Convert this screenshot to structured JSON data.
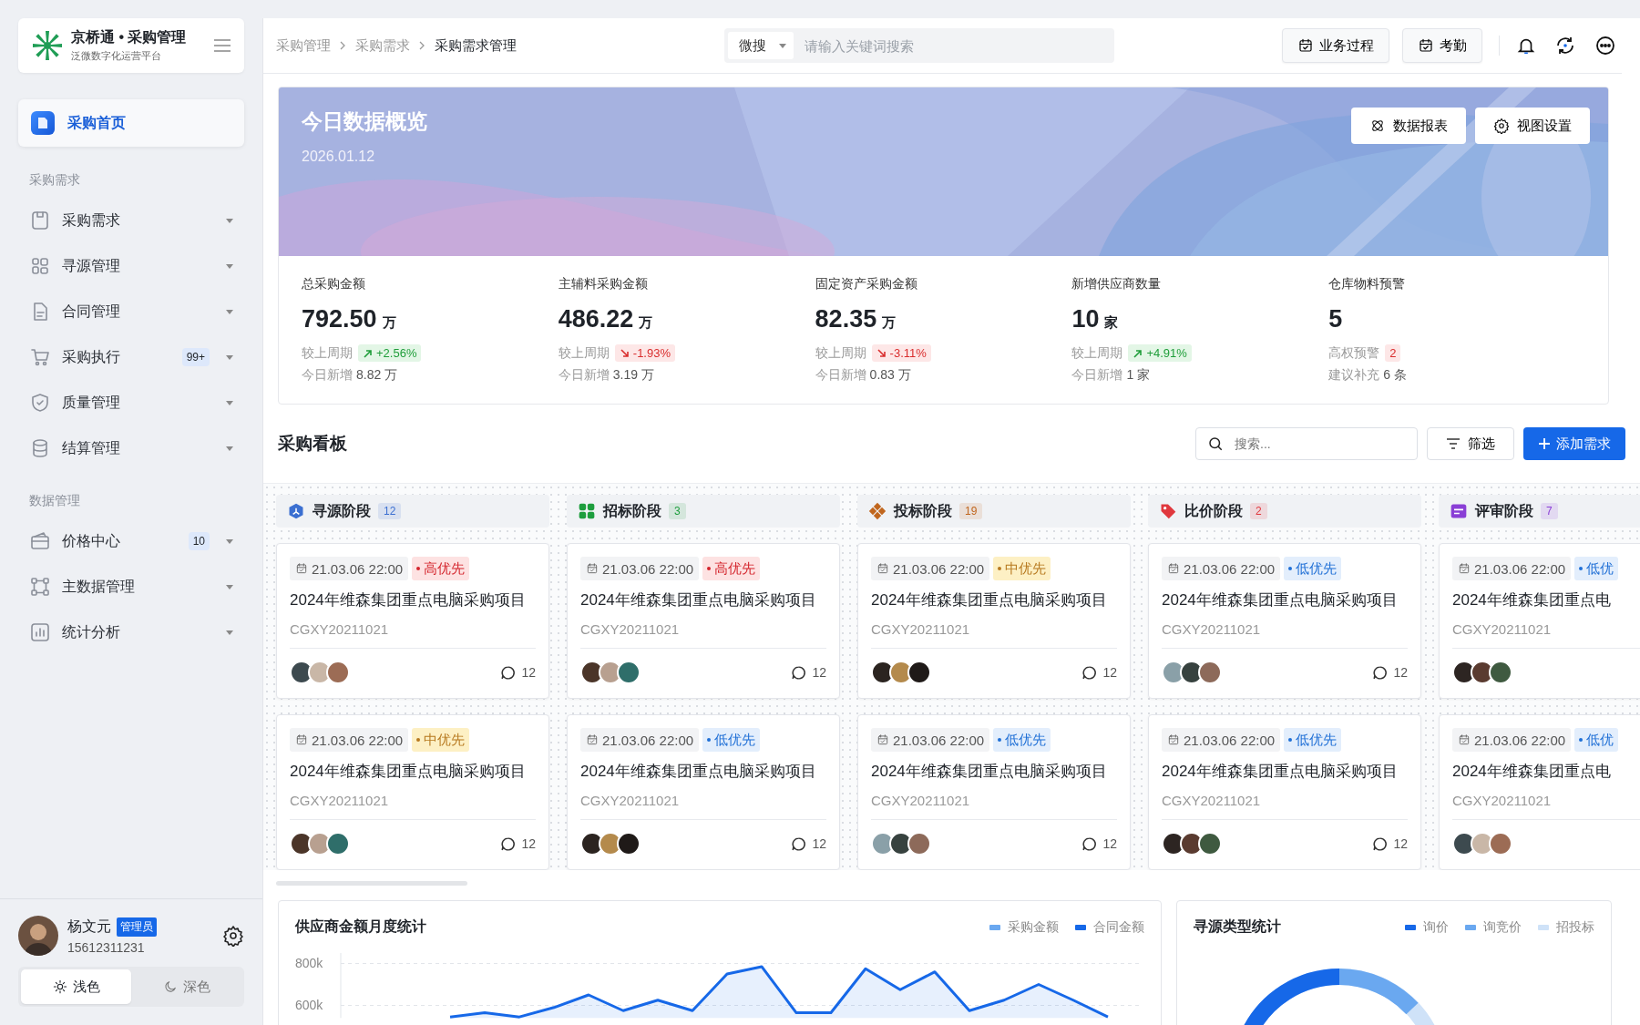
{
  "sidebar": {
    "brand": {
      "title": "京桥通 • 采购管理",
      "subtitle": "泛微数字化运营平台"
    },
    "home": {
      "label": "采购首页",
      "selected": true
    },
    "groups": [
      {
        "title": "采购需求",
        "items": [
          {
            "label": "采购需求"
          },
          {
            "label": "寻源管理"
          },
          {
            "label": "合同管理"
          },
          {
            "label": "采购执行",
            "badge": "99+"
          },
          {
            "label": "质量管理"
          },
          {
            "label": "结算管理"
          }
        ]
      },
      {
        "title": "数据管理",
        "items": [
          {
            "label": "价格中心",
            "badge": "10"
          },
          {
            "label": "主数据管理"
          },
          {
            "label": "统计分析"
          }
        ]
      }
    ],
    "user": {
      "name": "杨文元",
      "role": "管理员",
      "phone": "15612311231"
    },
    "themes": [
      {
        "label": "浅色",
        "selected": true
      },
      {
        "label": "深色",
        "selected": false
      }
    ]
  },
  "topbar": {
    "breadcrumb": [
      "采购管理",
      "采购需求",
      "采购需求管理"
    ],
    "search": {
      "scope": "微搜",
      "placeholder": "请输入关键词搜索"
    },
    "buttons": [
      "业务过程",
      "考勤"
    ]
  },
  "overview": {
    "title": "今日数据概览",
    "date": "2026.01.12",
    "buttons": [
      "数据报表",
      "视图设置"
    ],
    "stats": [
      {
        "label": "总采购金额",
        "value": "792.50",
        "unit": "万",
        "compare_label": "较上周期",
        "change": "+2.56%",
        "kind": "up",
        "sub_label": "今日新增",
        "sub_value": "8.82 万"
      },
      {
        "label": "主辅料采购金额",
        "value": "486.22",
        "unit": "万",
        "compare_label": "较上周期",
        "change": "-1.93%",
        "kind": "down",
        "sub_label": "今日新增",
        "sub_value": "3.19 万"
      },
      {
        "label": "固定资产采购金额",
        "value": "82.35",
        "unit": "万",
        "compare_label": "较上周期",
        "change": "-3.11%",
        "kind": "down",
        "sub_label": "今日新增",
        "sub_value": "0.83 万"
      },
      {
        "label": "新增供应商数量",
        "value": "10",
        "unit": "家",
        "compare_label": "较上周期",
        "change": "+4.91%",
        "kind": "up",
        "sub_label": "今日新增",
        "sub_value": "1 家"
      },
      {
        "label": "仓库物料预警",
        "value": "5",
        "compare_label": "高权预警",
        "change": "2",
        "kind": "alert",
        "sub_label": "建议补充",
        "sub_value": "6 条"
      }
    ]
  },
  "board": {
    "title": "采购看板",
    "search_placeholder": "搜索...",
    "filter": "筛选",
    "add": "添加需求",
    "columns": [
      {
        "title": "寻源阶段",
        "count": "12",
        "color": "#3b6fd1",
        "cards": [
          {
            "date": "21.03.06 22:00",
            "kind": "high",
            "tag": "高优先",
            "title": "2024年维森集团重点电脑采购项目",
            "code": "CGXY20211021",
            "comments": "12"
          },
          {
            "date": "21.03.06 22:00",
            "kind": "mid",
            "tag": "中优先",
            "title": "2024年维森集团重点电脑采购项目",
            "code": "CGXY20211021",
            "comments": "12"
          }
        ]
      },
      {
        "title": "招标阶段",
        "count": "3",
        "color": "#1e9e3e",
        "cards": [
          {
            "date": "21.03.06 22:00",
            "kind": "high",
            "tag": "高优先",
            "title": "2024年维森集团重点电脑采购项目",
            "code": "CGXY20211021",
            "comments": "12"
          },
          {
            "date": "21.03.06 22:00",
            "kind": "low",
            "tag": "低优先",
            "title": "2024年维森集团重点电脑采购项目",
            "code": "CGXY20211021",
            "comments": "12"
          }
        ]
      },
      {
        "title": "投标阶段",
        "count": "19",
        "color": "#c0661e",
        "cards": [
          {
            "date": "21.03.06 22:00",
            "kind": "mid",
            "tag": "中优先",
            "title": "2024年维森集团重点电脑采购项目",
            "code": "CGXY20211021",
            "comments": "12"
          },
          {
            "date": "21.03.06 22:00",
            "kind": "low",
            "tag": "低优先",
            "title": "2024年维森集团重点电脑采购项目",
            "code": "CGXY20211021",
            "comments": "12"
          }
        ]
      },
      {
        "title": "比价阶段",
        "count": "2",
        "color": "#e0383e",
        "cards": [
          {
            "date": "21.03.06 22:00",
            "kind": "low",
            "tag": "低优先",
            "title": "2024年维森集团重点电脑采购项目",
            "code": "CGXY20211021",
            "comments": "12"
          },
          {
            "date": "21.03.06 22:00",
            "kind": "low",
            "tag": "低优先",
            "title": "2024年维森集团重点电脑采购项目",
            "code": "CGXY20211021",
            "comments": "12"
          }
        ]
      },
      {
        "title": "评审阶段",
        "count": "7",
        "color": "#8a3fd6",
        "cards": [
          {
            "date": "21.03.06 22:00",
            "kind": "low",
            "tag": "低优",
            "title": "2024年维森集团重点电",
            "code": "CGXY20211021"
          },
          {
            "date": "21.03.06 22:00",
            "kind": "low",
            "tag": "低优",
            "title": "2024年维森集团重点电",
            "code": "CGXY20211021"
          }
        ]
      }
    ]
  },
  "charts": [
    {
      "title": "供应商金额月度统计",
      "chart_data": {
        "type": "area",
        "ylim": [
          540000,
          850000
        ],
        "yticks": [
          {
            "value": 600000,
            "label": "600k"
          },
          {
            "value": 800000,
            "label": "800k"
          }
        ],
        "series": [
          {
            "name": "采购金额",
            "color": "#6aa8f0",
            "values": [
              null,
              null,
              null,
              null,
              null,
              null,
              null,
              null,
              null,
              null,
              null,
              null,
              null,
              null,
              null,
              null,
              null,
              null,
              null,
              null
            ]
          },
          {
            "name": "合同金额",
            "color": "#1668e8",
            "values": [
              545000,
              565000,
              545000,
              590000,
              650000,
              575000,
              625000,
              575000,
              750000,
              785000,
              565000,
              565000,
              775000,
              675000,
              760000,
              575000,
              625000,
              700000,
              625000,
              545000
            ]
          }
        ]
      }
    },
    {
      "title": "寻源类型统计",
      "legend": [
        {
          "label": "询价",
          "color": "#1668e8"
        },
        {
          "label": "询竞价",
          "color": "#6aa8f0"
        },
        {
          "label": "招投标",
          "color": "#cfe2f8"
        }
      ]
    }
  ]
}
